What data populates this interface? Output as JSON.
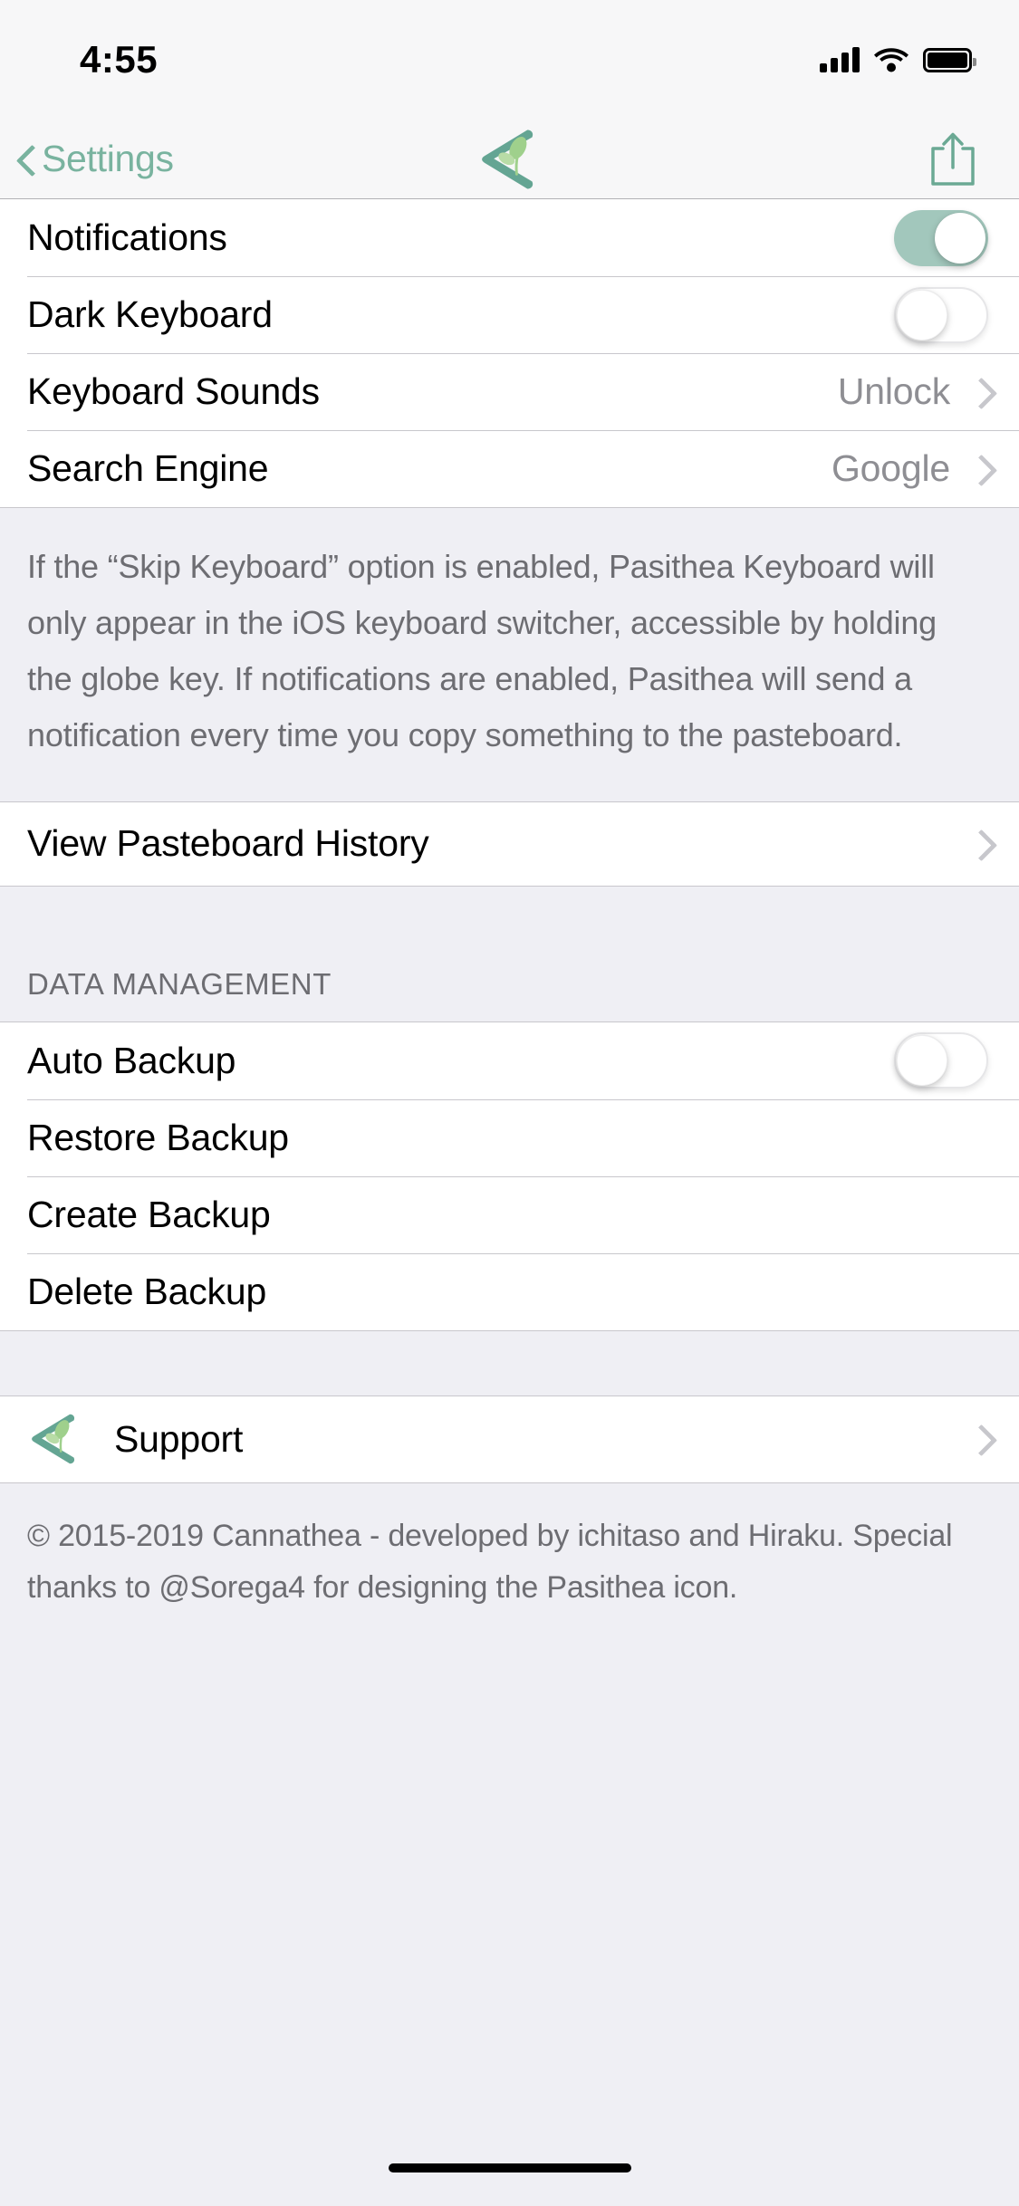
{
  "status_bar": {
    "time": "4:55",
    "signal_icon": "cellular-signal-icon",
    "wifi_icon": "wifi-icon",
    "battery_icon": "battery-full-icon"
  },
  "nav_bar": {
    "back_label": "Settings",
    "back_icon": "chevron-left-icon",
    "logo_icon": "pasithea-logo-icon",
    "share_icon": "share-icon",
    "accent_color": "#79B39F"
  },
  "section_main": {
    "rows": [
      {
        "label": "Notifications",
        "type": "toggle",
        "value": "on"
      },
      {
        "label": "Dark Keyboard",
        "type": "toggle",
        "value": "off"
      },
      {
        "label": "Keyboard Sounds",
        "type": "disclosure",
        "value": "Unlock"
      },
      {
        "label": "Search Engine",
        "type": "disclosure",
        "value": "Google"
      }
    ],
    "footer_note": "If the “Skip Keyboard” option is enabled, Pasithea Keyboard will only appear in the iOS keyboard switcher, accessible by holding the globe key. If notifications are enabled, Pasithea will send a notification every time you copy something to the pasteboard."
  },
  "section_pasteboard": {
    "rows": [
      {
        "label": "View Pasteboard History",
        "type": "disclosure",
        "value": ""
      }
    ]
  },
  "section_data_management": {
    "header": "DATA MANAGEMENT",
    "rows": [
      {
        "label": "Auto Backup",
        "type": "toggle",
        "value": "off"
      },
      {
        "label": "Restore Backup",
        "type": "plain",
        "value": ""
      },
      {
        "label": "Create Backup",
        "type": "plain",
        "value": ""
      },
      {
        "label": "Delete Backup",
        "type": "plain",
        "value": ""
      }
    ]
  },
  "section_support": {
    "label": "Support",
    "icon": "pasithea-logo-icon",
    "copyright": "© 2015-2019 Cannathea - developed by ichitaso and Hiraku. Special thanks to @Sorega4 for designing the Pasithea icon."
  },
  "colors": {
    "toggle_on": "#A2C7BC",
    "accent": "#79B39F",
    "group_background": "#EFEFF4",
    "separator": "#C8C7CC",
    "secondary_text": "#8E8E93"
  }
}
